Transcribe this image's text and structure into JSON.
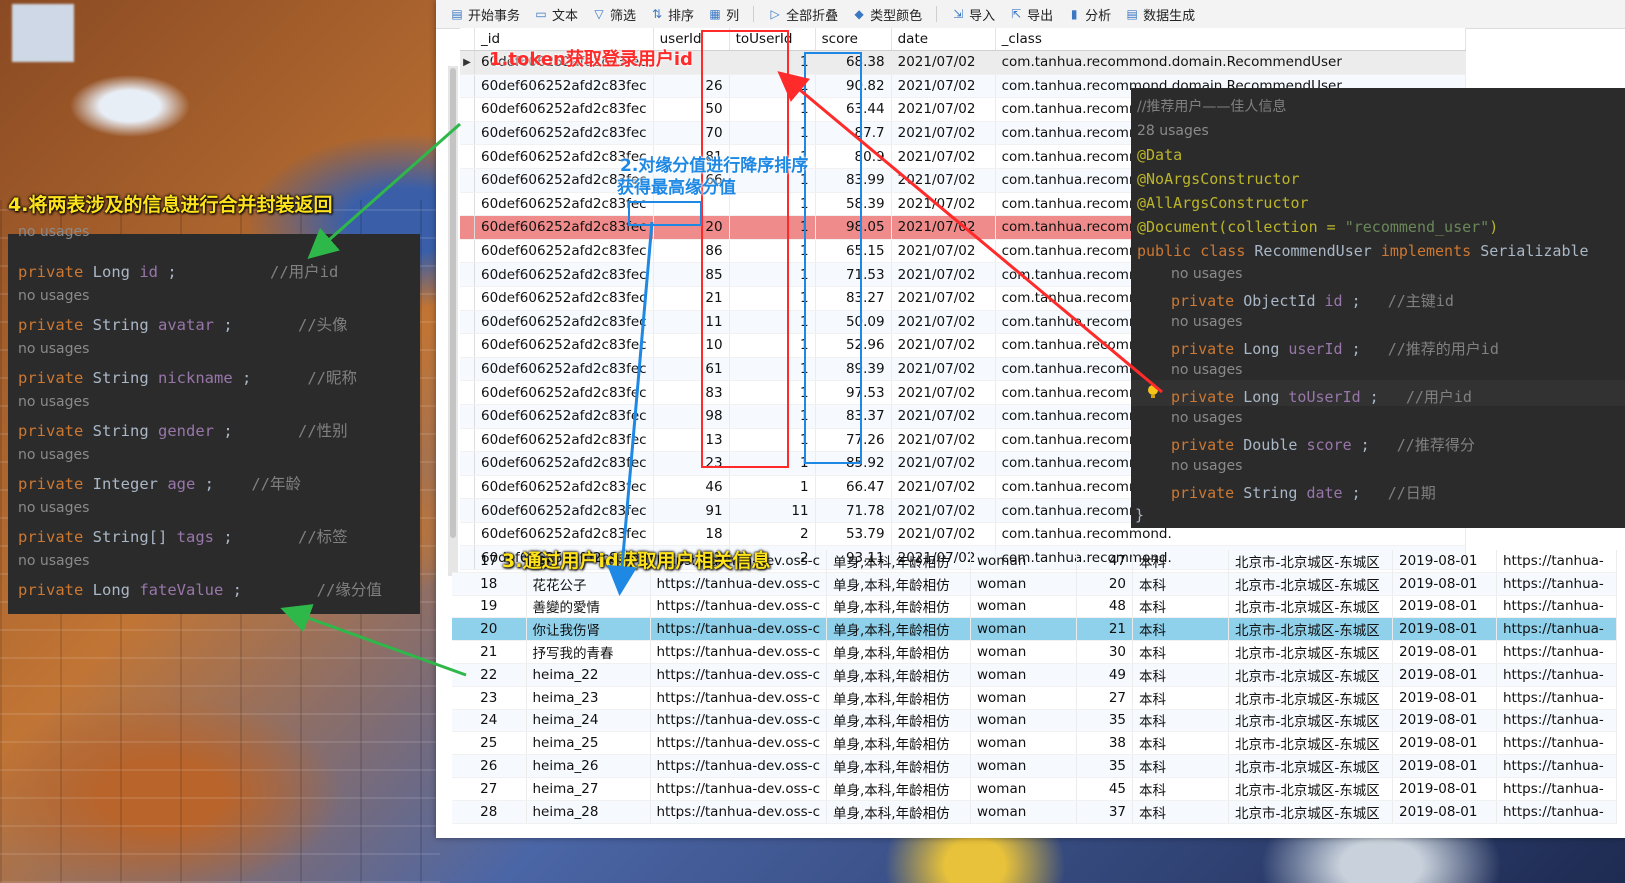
{
  "toolbar": {
    "items": [
      {
        "icon": "begin-transaction-icon",
        "label": "开始事务"
      },
      {
        "icon": "text-icon",
        "label": "文本"
      },
      {
        "icon": "filter-icon",
        "label": "筛选"
      },
      {
        "icon": "sort-icon",
        "label": "排序"
      },
      {
        "icon": "columns-icon",
        "label": "列"
      },
      {
        "icon": "fold-icon",
        "label": "全部折叠"
      },
      {
        "icon": "type-color-icon",
        "label": "类型颜色"
      },
      {
        "icon": "import-icon",
        "label": "导入"
      },
      {
        "icon": "export-icon",
        "label": "导出"
      },
      {
        "icon": "analyze-icon",
        "label": "分析"
      },
      {
        "icon": "data-generate-icon",
        "label": "数据生成"
      }
    ]
  },
  "recommend_table": {
    "columns": [
      "_id",
      "userId",
      "toUserId",
      "score",
      "date",
      "_class"
    ],
    "rows": [
      [
        "60def606252afd2c83fec",
        "",
        "1",
        "68.38",
        "2021/07/02",
        "com.tanhua.recommond.domain.RecommendUser"
      ],
      [
        "60def606252afd2c83fec",
        "26",
        "1",
        "90.82",
        "2021/07/02",
        "com.tanhua.recommond.domain.RecommendUser"
      ],
      [
        "60def606252afd2c83fec",
        "50",
        "1",
        "63.44",
        "2021/07/02",
        "com.tanhua.recommond."
      ],
      [
        "60def606252afd2c83fec",
        "70",
        "1",
        "87.7",
        "2021/07/02",
        "com.tanhua.recommond."
      ],
      [
        "60def606252afd2c83fec",
        "81",
        "1",
        "80.9",
        "2021/07/02",
        "com.tanhua.recommond."
      ],
      [
        "60def606252afd2c83fec",
        "66",
        "1",
        "83.99",
        "2021/07/02",
        "com.tanhua.recommond."
      ],
      [
        "60def606252afd2c83fec",
        "",
        "1",
        "58.39",
        "2021/07/02",
        "com.tanhua.recommond."
      ],
      [
        "60def606252afd2c83fec",
        "20",
        "1",
        "98.05",
        "2021/07/02",
        "com.tanhua.recommond."
      ],
      [
        "60def606252afd2c83fec",
        "86",
        "1",
        "65.15",
        "2021/07/02",
        "com.tanhua.recommond."
      ],
      [
        "60def606252afd2c83fec",
        "85",
        "1",
        "71.53",
        "2021/07/02",
        "com.tanhua.recommond."
      ],
      [
        "60def606252afd2c83fec",
        "21",
        "1",
        "83.27",
        "2021/07/02",
        "com.tanhua.recommond."
      ],
      [
        "60def606252afd2c83fec",
        "11",
        "1",
        "50.09",
        "2021/07/02",
        "com.tanhua.recommond."
      ],
      [
        "60def606252afd2c83fec",
        "10",
        "1",
        "52.96",
        "2021/07/02",
        "com.tanhua.recommond."
      ],
      [
        "60def606252afd2c83fec",
        "61",
        "1",
        "89.39",
        "2021/07/02",
        "com.tanhua.recommond."
      ],
      [
        "60def606252afd2c83fec",
        "83",
        "1",
        "97.53",
        "2021/07/02",
        "com.tanhua.recommond."
      ],
      [
        "60def606252afd2c83fec",
        "98",
        "1",
        "83.37",
        "2021/07/02",
        "com.tanhua.recommond."
      ],
      [
        "60def606252afd2c83fec",
        "13",
        "1",
        "77.26",
        "2021/07/02",
        "com.tanhua.recommond."
      ],
      [
        "60def606252afd2c83fec",
        "23",
        "1",
        "85.92",
        "2021/07/02",
        "com.tanhua.recommond."
      ],
      [
        "60def606252afd2c83fec",
        "46",
        "1",
        "66.47",
        "2021/07/02",
        "com.tanhua.recommond."
      ],
      [
        "60def606252afd2c83fec",
        "91",
        "11",
        "71.78",
        "2021/07/02",
        "com.tanhua.recommond."
      ],
      [
        "60def606252afd2c83fec",
        "18",
        "2",
        "53.79",
        "2021/07/02",
        "com.tanhua.recommond."
      ],
      [
        "60def606252afd2c83fec",
        "82",
        "2",
        "93.11",
        "2021/07/02",
        "com.tanhua.recommond."
      ]
    ]
  },
  "userinfo_table": {
    "rows": [
      [
        "17",
        "康贝",
        "https://tanhua-dev.oss-c",
        "单身,本科,年龄相仿",
        "woman",
        "47",
        "本科",
        "北京市-北京城区-东城区",
        "2019-08-01",
        "https://tanhua-"
      ],
      [
        "18",
        "花花公子",
        "https://tanhua-dev.oss-c",
        "单身,本科,年龄相仿",
        "woman",
        "20",
        "本科",
        "北京市-北京城区-东城区",
        "2019-08-01",
        "https://tanhua-"
      ],
      [
        "19",
        "善變的愛情",
        "https://tanhua-dev.oss-c",
        "单身,本科,年龄相仿",
        "woman",
        "48",
        "本科",
        "北京市-北京城区-东城区",
        "2019-08-01",
        "https://tanhua-"
      ],
      [
        "20",
        "你让我伤肾",
        "https://tanhua-dev.oss-c",
        "单身,本科,年龄相仿",
        "woman",
        "21",
        "本科",
        "北京市-北京城区-东城区",
        "2019-08-01",
        "https://tanhua-"
      ],
      [
        "21",
        "抒写我的青春",
        "https://tanhua-dev.oss-c",
        "单身,本科,年龄相仿",
        "woman",
        "30",
        "本科",
        "北京市-北京城区-东城区",
        "2019-08-01",
        "https://tanhua-"
      ],
      [
        "22",
        "heima_22",
        "https://tanhua-dev.oss-c",
        "单身,本科,年龄相仿",
        "woman",
        "49",
        "本科",
        "北京市-北京城区-东城区",
        "2019-08-01",
        "https://tanhua-"
      ],
      [
        "23",
        "heima_23",
        "https://tanhua-dev.oss-c",
        "单身,本科,年龄相仿",
        "woman",
        "27",
        "本科",
        "北京市-北京城区-东城区",
        "2019-08-01",
        "https://tanhua-"
      ],
      [
        "24",
        "heima_24",
        "https://tanhua-dev.oss-c",
        "单身,本科,年龄相仿",
        "woman",
        "35",
        "本科",
        "北京市-北京城区-东城区",
        "2019-08-01",
        "https://tanhua-"
      ],
      [
        "25",
        "heima_25",
        "https://tanhua-dev.oss-c",
        "单身,本科,年龄相仿",
        "woman",
        "38",
        "本科",
        "北京市-北京城区-东城区",
        "2019-08-01",
        "https://tanhua-"
      ],
      [
        "26",
        "heima_26",
        "https://tanhua-dev.oss-c",
        "单身,本科,年龄相仿",
        "woman",
        "35",
        "本科",
        "北京市-北京城区-东城区",
        "2019-08-01",
        "https://tanhua-"
      ],
      [
        "27",
        "heima_27",
        "https://tanhua-dev.oss-c",
        "单身,本科,年龄相仿",
        "woman",
        "45",
        "本科",
        "北京市-北京城区-东城区",
        "2019-08-01",
        "https://tanhua-"
      ],
      [
        "28",
        "heima_28",
        "https://tanhua-dev.oss-c",
        "单身,本科,年龄相仿",
        "woman",
        "37",
        "本科",
        "北京市-北京城区-东城区",
        "2019-08-01",
        "https://tanhua-"
      ]
    ]
  },
  "code_left": {
    "top_usage": "no usages",
    "usage_label": "no usages",
    "fields": [
      {
        "mod": "private",
        "type": "Long",
        "name": "id",
        "comment": "//用户id"
      },
      {
        "mod": "private",
        "type": "String",
        "name": "avatar",
        "comment": "//头像"
      },
      {
        "mod": "private",
        "type": "String",
        "name": "nickname",
        "comment": "//昵称"
      },
      {
        "mod": "private",
        "type": "String",
        "name": "gender",
        "comment": "//性别"
      },
      {
        "mod": "private",
        "type": "Integer",
        "name": "age",
        "comment": "//年龄"
      },
      {
        "mod": "private",
        "type": "String[]",
        "name": "tags",
        "comment": "//标签"
      },
      {
        "mod": "private",
        "type": "Long",
        "name": "fateValue",
        "comment": "//缘分值"
      }
    ]
  },
  "code_right": {
    "doc_comment": "//推荐用户——佳人信息",
    "usages": "28 usages",
    "annotations": [
      "@Data",
      "@NoArgsConstructor",
      "@AllArgsConstructor"
    ],
    "document_anno": "@Document(collection = ",
    "document_value": "\"recommend_user\"",
    "document_close": ")",
    "class_decl_kw": "public class",
    "class_name": "RecommendUser",
    "implements_kw": "implements",
    "interface": "Serializable",
    "usage_label": "no usages",
    "fields": [
      {
        "mod": "private",
        "type": "ObjectId",
        "name": "id",
        "comment": "//主键id"
      },
      {
        "mod": "private",
        "type": "Long",
        "name": "userId",
        "comment": "//推荐的用户id"
      },
      {
        "mod": "private",
        "type": "Long",
        "name": "toUserId",
        "comment": "//用户id"
      },
      {
        "mod": "private",
        "type": "Double",
        "name": "score",
        "comment": "//推荐得分"
      },
      {
        "mod": "private",
        "type": "String",
        "name": "date",
        "comment": "//日期"
      }
    ],
    "closing": "}"
  },
  "annotations": {
    "step1": "1.token获取登录用户id",
    "step2_line1": "2.对缘分值进行降序排序",
    "step2_line2": "获得最高缘分值",
    "step3": "3.通过用户id获取用户相关信息",
    "step4": "4.将两表涉及的信息进行合并封装返回"
  },
  "colors": {
    "red": "#ff2a2a",
    "blue": "#1e88e5",
    "green": "#2fb84a",
    "yellow": "#ffe31a",
    "row_highlight": "#f08b8b",
    "lower_highlight": "#8fd0ea"
  }
}
